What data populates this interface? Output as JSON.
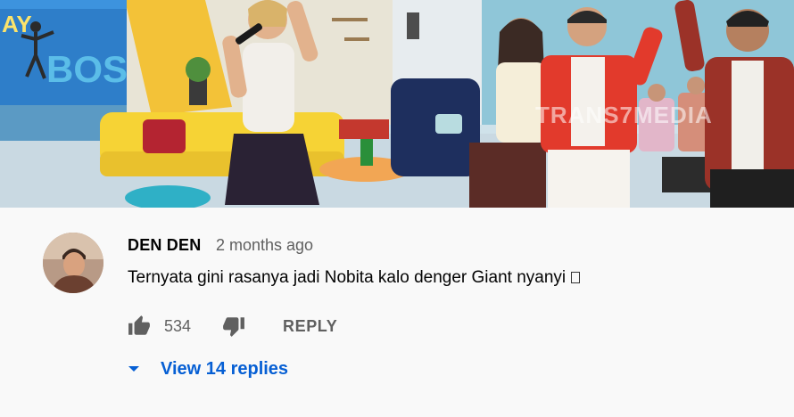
{
  "video": {
    "overlay_text_1": "AY",
    "overlay_text_2": "BOS",
    "watermark": "TRANS7MEDIA"
  },
  "comment": {
    "author": "DEN DEN",
    "time": "2 months ago",
    "text": "Ternyata gini rasanya jadi Nobita kalo denger Giant nyanyi",
    "like_count": "534",
    "reply_label": "REPLY",
    "view_replies_label": "View 14 replies"
  },
  "colors": {
    "link_blue": "#065fd4",
    "secondary_text": "#606060",
    "primary_text": "#030303",
    "background": "#f9f9f9"
  },
  "icons": {
    "like": "thumb-up-icon",
    "dislike": "thumb-down-icon",
    "expand": "caret-down-icon",
    "emoji": "unsupported-glyph-icon"
  }
}
